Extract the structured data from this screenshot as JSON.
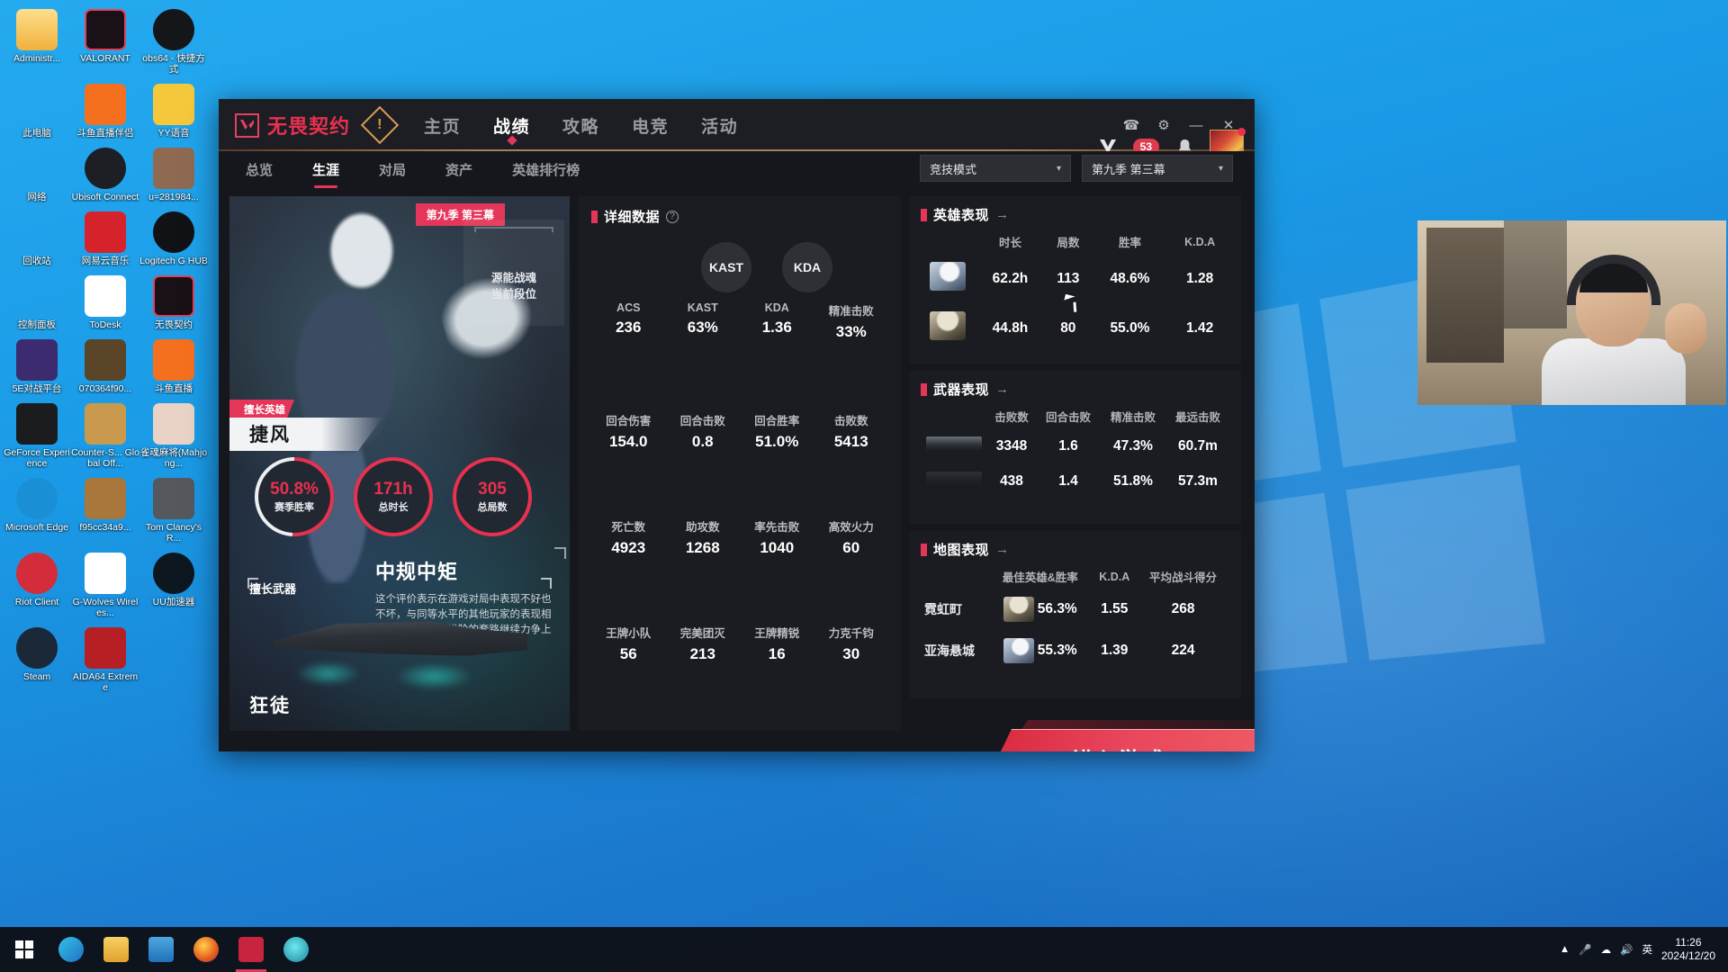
{
  "desktop": {
    "icons": [
      {
        "label": "Administr...",
        "icon": "user-folder-icon",
        "color": "#f5c14e"
      },
      {
        "label": "VALORANT",
        "icon": "valorant-icon",
        "color": "#1a1118"
      },
      {
        "label": "obs64 - 快捷方式",
        "icon": "obs-icon",
        "color": "#15161a"
      },
      {
        "label": "此电脑",
        "icon": "this-pc-icon",
        "color": "#3a7fc4"
      },
      {
        "label": "斗鱼直播伴侣",
        "icon": "douyu-companion-icon",
        "color": "#f4701f"
      },
      {
        "label": "YY语音",
        "icon": "yy-voice-icon",
        "color": "#f5c73a"
      },
      {
        "label": "网络",
        "icon": "network-icon",
        "color": "#2f72b8"
      },
      {
        "label": "Ubisoft Connect",
        "icon": "ubisoft-connect-icon",
        "color": "#1d1f24"
      },
      {
        "label": "u=281984...",
        "icon": "image-thumb-icon",
        "color": "#8f6a52"
      },
      {
        "label": "回收站",
        "icon": "recycle-bin-icon",
        "color": "#8fd2ef"
      },
      {
        "label": "网易云音乐",
        "icon": "netease-music-icon",
        "color": "#d6232b"
      },
      {
        "label": "Logitech G HUB",
        "icon": "logitech-ghub-icon",
        "color": "#111215"
      },
      {
        "label": "控制面板",
        "icon": "control-panel-icon",
        "color": "#d9e7f3"
      },
      {
        "label": "ToDesk",
        "icon": "todesk-icon",
        "color": "#ffffff"
      },
      {
        "label": "无畏契约",
        "icon": "valorant-cn-icon",
        "color": "#1a1118"
      },
      {
        "label": "5E对战平台",
        "icon": "5e-platform-icon",
        "color": "#3c2b6e"
      },
      {
        "label": "070364f90...",
        "icon": "new-knife-icon",
        "color": "#5a4528"
      },
      {
        "label": "斗鱼直播",
        "icon": "douyu-live-icon",
        "color": "#f4701f"
      },
      {
        "label": "GeForce Experience",
        "icon": "geforce-icon",
        "color": "#1b1c1e"
      },
      {
        "label": "Counter-S... Global Off...",
        "icon": "csgo-icon",
        "color": "#c99a4e"
      },
      {
        "label": "雀魂麻将(Mahjong...",
        "icon": "mahjong-soul-icon",
        "color": "#e8d3c6"
      },
      {
        "label": "Microsoft Edge",
        "icon": "edge-icon",
        "color": "#1b8fd6"
      },
      {
        "label": "f95cc34a9...",
        "icon": "image-thumb2-icon",
        "color": "#a9763c"
      },
      {
        "label": "Tom Clancy's R...",
        "icon": "rainbow-six-icon",
        "color": "#55585c"
      },
      {
        "label": "Riot Client",
        "icon": "riot-client-icon",
        "color": "#d32d3c"
      },
      {
        "label": "G-Wolves Wireles...",
        "icon": "gwolves-icon",
        "color": "#ffffff"
      },
      {
        "label": "UU加速器",
        "icon": "uu-booster-icon",
        "color": "#0d1720"
      },
      {
        "label": "Steam",
        "icon": "steam-icon",
        "color": "#1b2838"
      },
      {
        "label": "AIDA64 Extreme",
        "icon": "aida64-icon",
        "color": "#b61f24"
      }
    ]
  },
  "taskbar": {
    "start_label": "start-icon",
    "items": [
      {
        "name": "edge-taskbar-icon",
        "color": "#2d8fd4"
      },
      {
        "name": "file-explorer-taskbar-icon",
        "color": "#f6c44e"
      },
      {
        "name": "store-taskbar-icon",
        "color": "#2d8fd4"
      },
      {
        "name": "firefox-taskbar-icon",
        "color": "#e35b1d"
      },
      {
        "name": "valorant-taskbar-icon",
        "color": "#c9243f"
      },
      {
        "name": "douyu-taskbar-icon",
        "color": "#29b5c9"
      }
    ],
    "tray": {
      "chevron": "▲",
      "mic": "mic-icon",
      "network": "network-tray-icon",
      "volume": "volume-icon",
      "ime": "英",
      "time": "11:26",
      "date": "2024/12/20"
    }
  },
  "client": {
    "brand": "无畏契约",
    "warning_glyph": "!",
    "nav": [
      {
        "label": "主页",
        "active": false
      },
      {
        "label": "战绩",
        "active": true
      },
      {
        "label": "攻略",
        "active": false
      },
      {
        "label": "电竞",
        "active": false
      },
      {
        "label": "活动",
        "active": false
      }
    ],
    "titlebar_icons": [
      {
        "name": "headset-icon",
        "glyph": "☎"
      },
      {
        "name": "settings-gear-icon",
        "glyph": "⚙"
      },
      {
        "name": "minimize-icon",
        "glyph": "—"
      },
      {
        "name": "close-icon",
        "glyph": "✕"
      }
    ],
    "account": {
      "vp_icon": "valorant-points-icon",
      "vp_amount": "53",
      "bell_icon": "notification-bell-icon",
      "avatar": "player-avatar"
    },
    "subtabs": [
      {
        "label": "总览",
        "active": false
      },
      {
        "label": "生涯",
        "active": true
      },
      {
        "label": "对局",
        "active": false
      },
      {
        "label": "资产",
        "active": false
      },
      {
        "label": "英雄排行榜",
        "active": false
      }
    ],
    "filters": [
      {
        "name": "mode-select",
        "value": "竞技模式"
      },
      {
        "name": "season-select",
        "value": "第九季 第三幕"
      }
    ],
    "profile": {
      "season_chip": "第九季 第三幕",
      "rank_name": "源能战魂",
      "rank_caption": "当前段位",
      "best_agent_tag": "擅长英雄",
      "best_agent_name": "捷风",
      "rings": [
        {
          "value": "50.8%",
          "label": "赛季胜率",
          "pct": 50.8
        },
        {
          "value": "171h",
          "label": "总时长",
          "pct": 100
        },
        {
          "value": "305",
          "label": "总局数",
          "pct": 100
        }
      ],
      "grade_title": "中规中矩",
      "grade_desc": "这个评价表示在游戏对局中表现不好也不坏，与同等水平的其他玩家的表现相匹配，可以学习进阶的套路继续力争上游。",
      "weapon_label": "擅长武器",
      "weapon_name": "狂徒"
    },
    "detail": {
      "title": "详细数据",
      "help": "?",
      "bubbles": [
        {
          "label": "KAST"
        },
        {
          "label": "KDA"
        }
      ],
      "rows": [
        [
          {
            "label": "ACS",
            "value": "236"
          },
          {
            "label": "KAST",
            "value": "63%"
          },
          {
            "label": "KDA",
            "value": "1.36"
          },
          {
            "label": "精准击败",
            "value": "33%"
          }
        ],
        [
          {
            "label": "回合伤害",
            "value": "154.0"
          },
          {
            "label": "回合击败",
            "value": "0.8"
          },
          {
            "label": "回合胜率",
            "value": "51.0%"
          },
          {
            "label": "击败数",
            "value": "5413"
          }
        ],
        [
          {
            "label": "死亡数",
            "value": "4923"
          },
          {
            "label": "助攻数",
            "value": "1268"
          },
          {
            "label": "率先击败",
            "value": "1040"
          },
          {
            "label": "高效火力",
            "value": "60"
          }
        ],
        [
          {
            "label": "王牌小队",
            "value": "56"
          },
          {
            "label": "完美团灭",
            "value": "213"
          },
          {
            "label": "王牌精锐",
            "value": "16"
          },
          {
            "label": "力克千钧",
            "value": "30"
          }
        ]
      ]
    },
    "agent_panel": {
      "title": "英雄表现",
      "arrow": "→",
      "columns": [
        "",
        "时长",
        "局数",
        "胜率",
        "K.D.A"
      ],
      "rows": [
        {
          "portrait": "jett-portrait",
          "cells": [
            "62.2h",
            "113",
            "48.6%",
            "1.28"
          ]
        },
        {
          "portrait": "cypher-portrait",
          "cells": [
            "44.8h",
            "80",
            "55.0%",
            "1.42"
          ]
        }
      ]
    },
    "weapon_panel": {
      "title": "武器表现",
      "arrow": "→",
      "columns": [
        "",
        "击败数",
        "回合击败",
        "精准击败",
        "最远击败"
      ],
      "rows": [
        {
          "portrait": "vandal-weapon-icon",
          "cells": [
            "3348",
            "1.6",
            "47.3%",
            "60.7m"
          ]
        },
        {
          "portrait": "phantom-weapon-icon",
          "cells": [
            "438",
            "1.4",
            "51.8%",
            "57.3m"
          ]
        }
      ]
    },
    "map_panel": {
      "title": "地图表现",
      "arrow": "→",
      "columns": [
        "",
        "最佳英雄&胜率",
        "K.D.A",
        "平均战斗得分"
      ],
      "rows": [
        {
          "map": "霓虹町",
          "portrait": "cypher-portrait",
          "cells": [
            "56.3%",
            "1.55",
            "268"
          ]
        },
        {
          "map": "亚海悬城",
          "portrait": "jett-portrait",
          "cells": [
            "55.3%",
            "1.39",
            "224"
          ]
        }
      ]
    },
    "play_button": "进入游戏"
  },
  "colors": {
    "accent_red": "#e4365a",
    "panel_bg": "#1b1c21",
    "window_bg": "#16171c",
    "gold": "#d2a36a"
  }
}
